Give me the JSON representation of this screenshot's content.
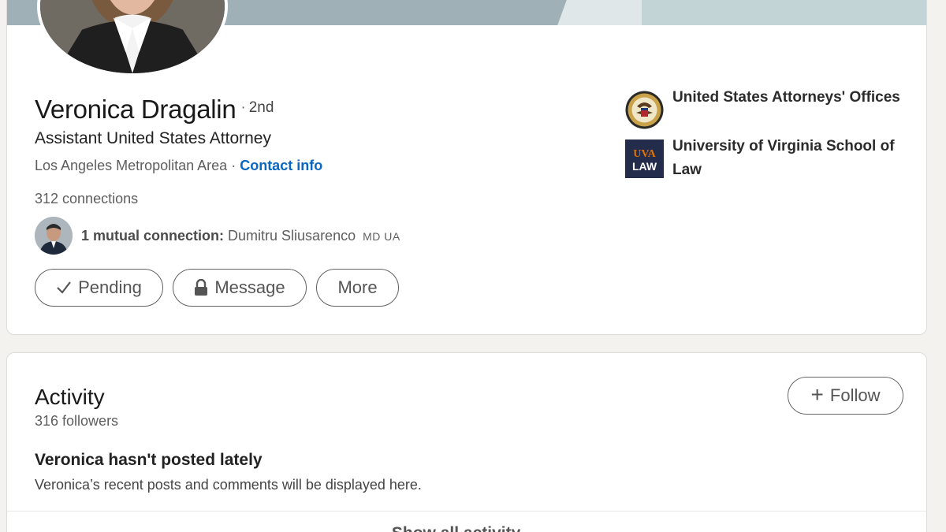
{
  "profile": {
    "name": "Veronica Dragalin",
    "degree_separator": "·",
    "degree": "2nd",
    "headline": "Assistant United States Attorney",
    "location": "Los Angeles Metropolitan Area",
    "location_separator": "·",
    "contact_info_label": "Contact info",
    "connections": "312 connections",
    "mutual_label": "1 mutual connection:",
    "mutual_name": "Dumitru Sliusarenco",
    "mutual_flags": "MD UA",
    "buttons": {
      "pending": "Pending",
      "message": "Message",
      "more": "More"
    },
    "organizations": [
      {
        "name": "United States Attorneys' Offices",
        "icon": "doj-seal-icon"
      },
      {
        "name": "University of Virginia School of Law",
        "icon": "uva-law-logo"
      }
    ]
  },
  "activity": {
    "title": "Activity",
    "followers": "316 followers",
    "follow_label": "Follow",
    "empty_title": "Veronica hasn't posted lately",
    "empty_desc": "Veronica’s recent posts and comments will be displayed here.",
    "show_all_label": "Show all activity →"
  },
  "logo_text": {
    "uva_top": "UVA",
    "uva_bottom": "LAW"
  },
  "colors": {
    "link": "#0a66c2",
    "page_bg": "#f3f2ef",
    "banner": "#9fb1b6",
    "uva_navy": "#232d4b",
    "uva_orange": "#e57200"
  }
}
